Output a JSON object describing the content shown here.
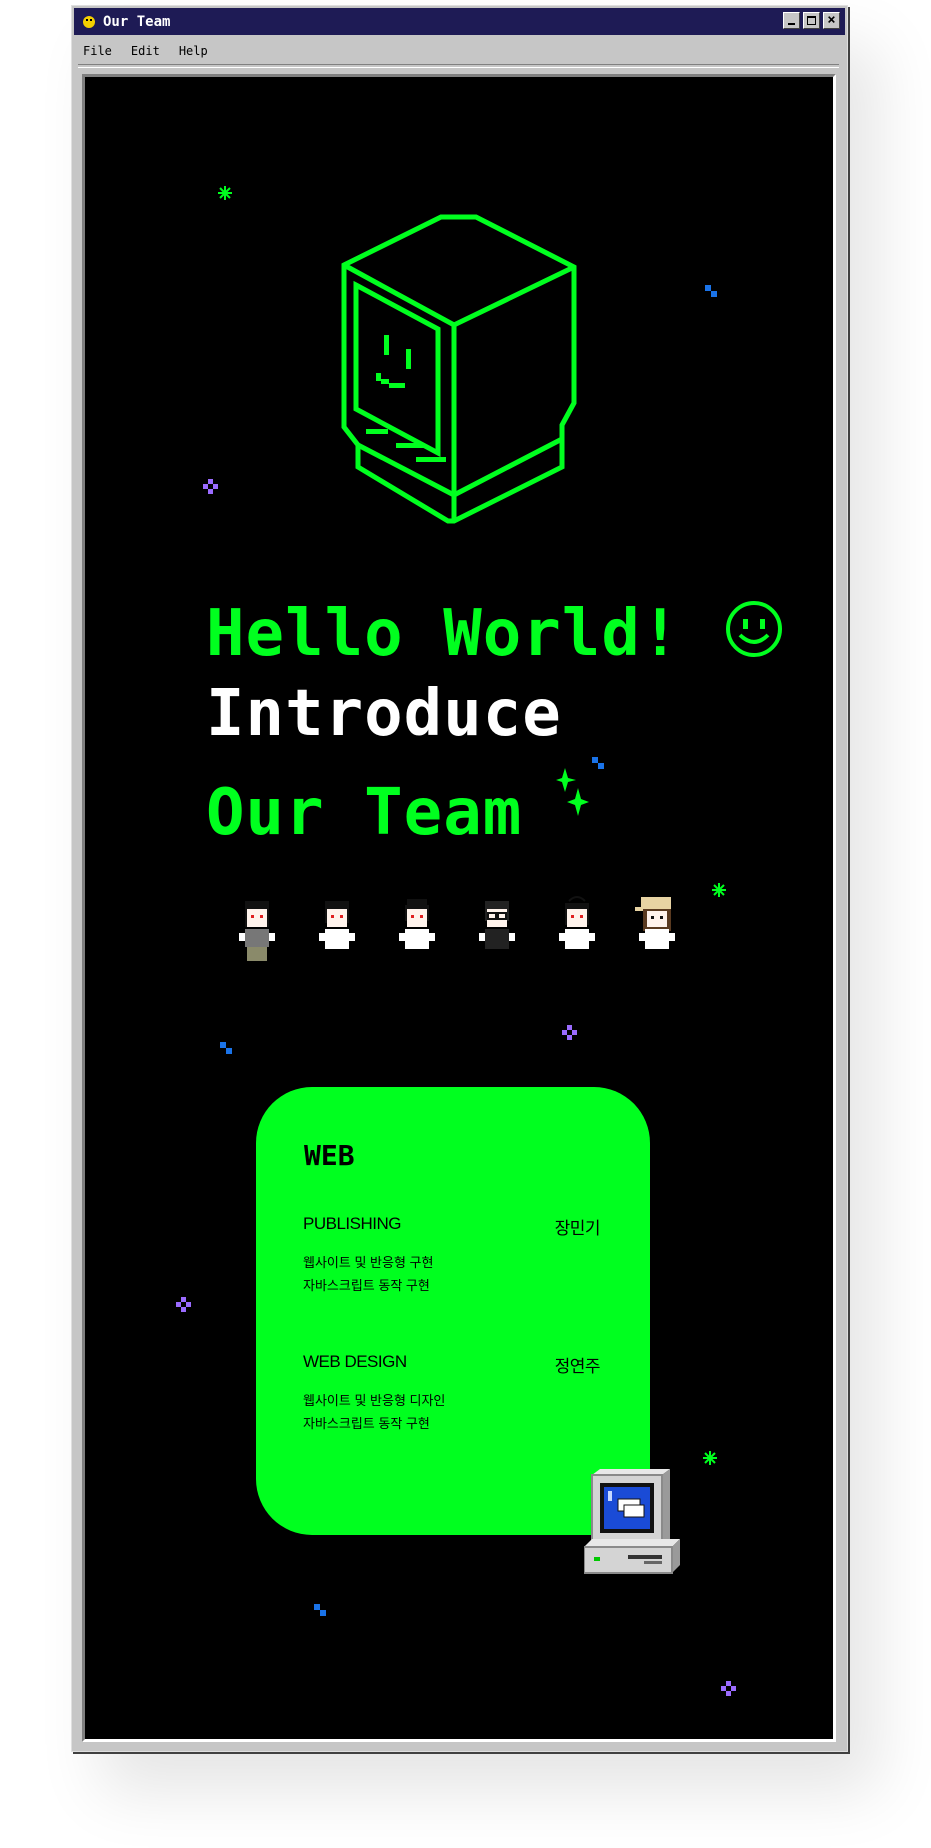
{
  "window": {
    "title": "Our Team"
  },
  "menu": {
    "items": [
      "File",
      "Edit",
      "Help"
    ]
  },
  "hero": {
    "line1": "Hello World!",
    "line2": "Introduce",
    "line3": "Our Team"
  },
  "team": {
    "members": [
      "member-1",
      "member-2",
      "member-3",
      "member-4",
      "member-5",
      "member-6"
    ]
  },
  "card": {
    "title": "WEB",
    "roles": [
      {
        "title": "PUBLISHING",
        "name": "장민기",
        "desc": [
          "웹사이트 및 반응형 구현",
          "자바스크립트 동작 구현"
        ]
      },
      {
        "title": "WEB DESIGN",
        "name": "정연주",
        "desc": [
          "웹사이트 및 반응형 디자인",
          "자바스크립트 동작 구현"
        ]
      }
    ]
  },
  "colors": {
    "accent": "#00ff1f",
    "background": "#000000",
    "titlebar": "#1e1b55",
    "sparkle_blue": "#1a73e8",
    "sparkle_purple": "#9b6bff"
  }
}
